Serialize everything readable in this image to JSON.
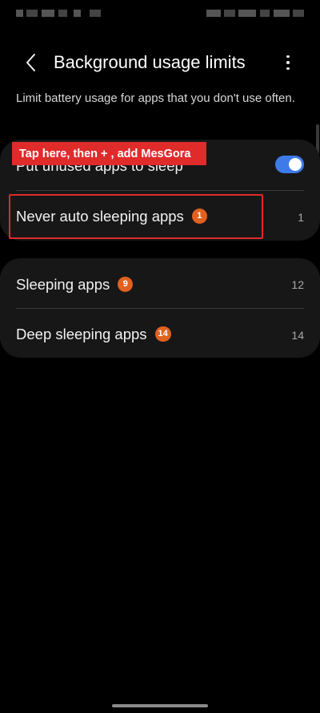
{
  "header": {
    "title": "Background usage limits",
    "back_icon": "chevron-left-icon",
    "more_icon": "more-vertical-icon"
  },
  "description": "Limit battery usage for apps that you don't use often.",
  "settings": {
    "put_unused_to_sleep": {
      "label": "Put unused apps to sleep",
      "enabled": true
    },
    "never_auto_sleeping": {
      "label": "Never auto sleeping apps",
      "badge": "1",
      "count": "1"
    },
    "sleeping": {
      "label": "Sleeping apps",
      "badge": "9",
      "count": "12"
    },
    "deep_sleeping": {
      "label": "Deep sleeping apps",
      "badge": "14",
      "count": "14"
    }
  },
  "annotation": {
    "banner_text": "Tap here, then + , add MesGora"
  },
  "colors": {
    "accent_toggle": "#3e7be8",
    "badge": "#e0611f",
    "annotation_red": "#e02b2b",
    "card_bg": "#171717"
  }
}
